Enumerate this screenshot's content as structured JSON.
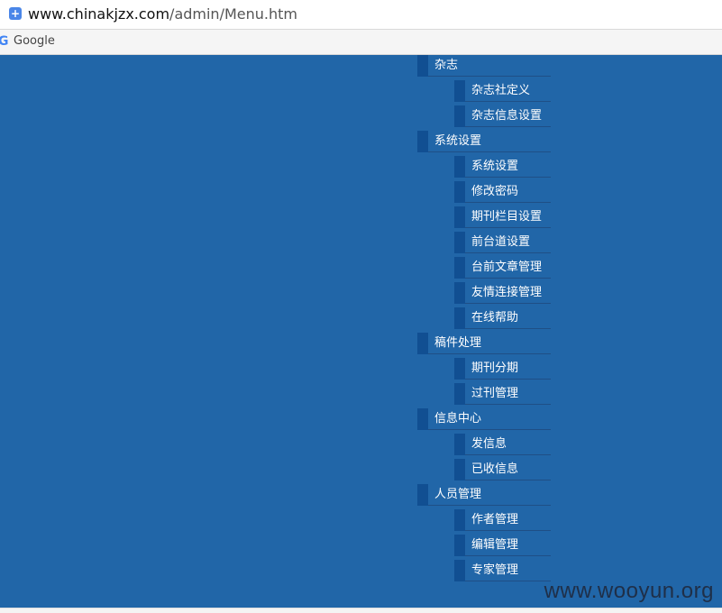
{
  "browser": {
    "url_host": "www.chinakjzx.com",
    "url_path": "/admin/Menu.htm",
    "bookmark_label": "Google",
    "site_icon": "plus-icon",
    "bookmark_icon": "google-icon"
  },
  "menu": {
    "sections": [
      {
        "label": "杂志",
        "items": [
          "杂志社定义",
          "杂志信息设置"
        ]
      },
      {
        "label": "系统设置",
        "items": [
          "系统设置",
          "修改密码",
          "期刊栏目设置",
          "前台道设置",
          "台前文章管理",
          "友情连接管理",
          "在线帮助"
        ]
      },
      {
        "label": "稿件处理",
        "items": [
          "期刊分期",
          "过刊管理"
        ]
      },
      {
        "label": "信息中心",
        "items": [
          "发信息",
          "已收信息"
        ]
      },
      {
        "label": "人员管理",
        "items": [
          "作者管理",
          "编辑管理",
          "专家管理"
        ]
      }
    ]
  },
  "watermark": "www.wooyun.org",
  "colors": {
    "page_background": "#2166a8",
    "menu_marker": "#114f92",
    "menu_text": "#ffffff"
  }
}
